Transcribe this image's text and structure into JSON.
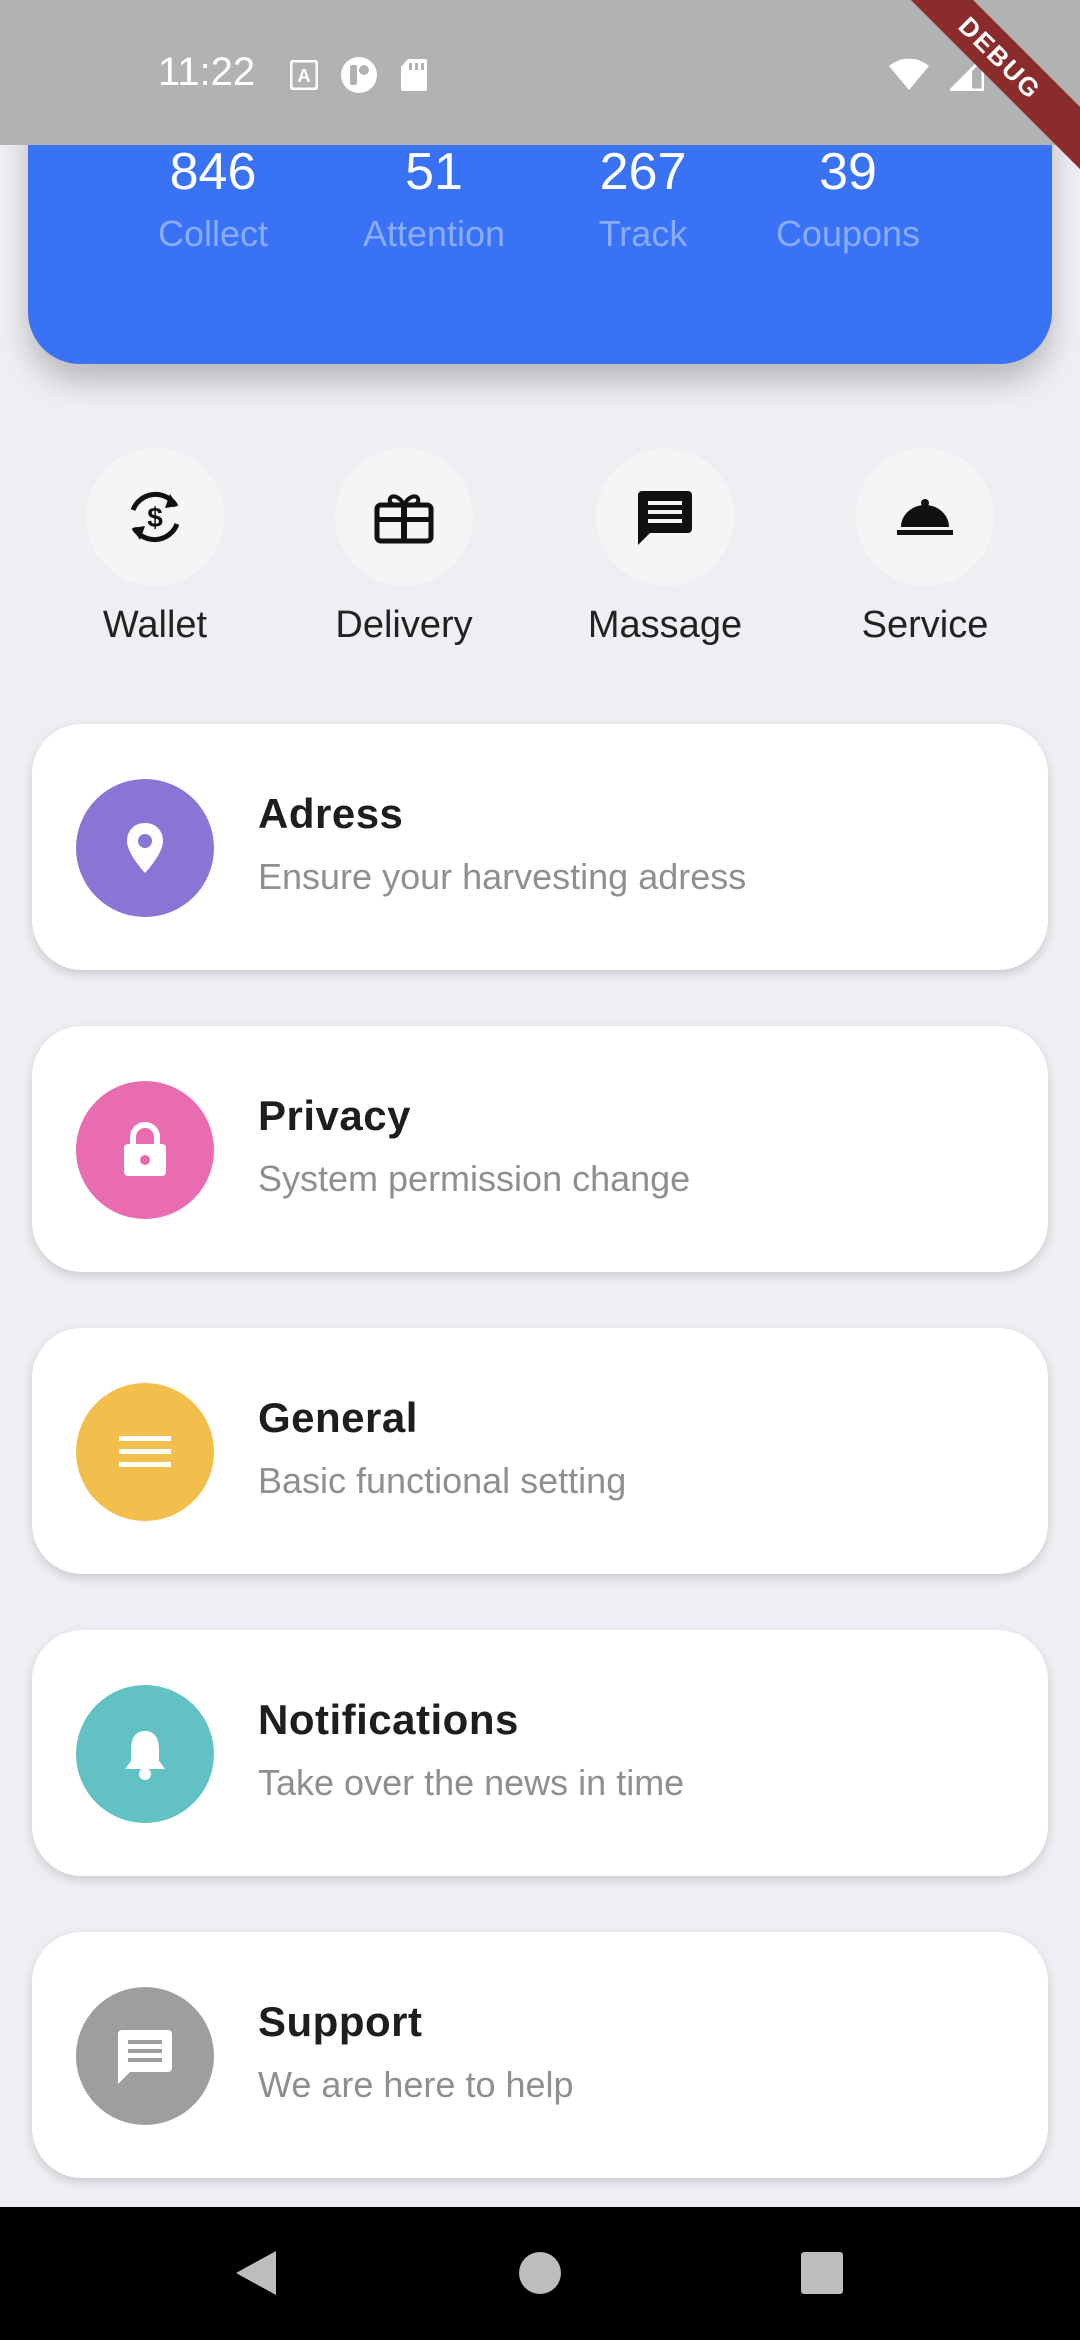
{
  "status_bar": {
    "time": "11:22",
    "left_icons": [
      "a-box-icon",
      "app-icon",
      "sd-card-icon"
    ],
    "right_icons": [
      "wifi-icon",
      "signal-icon",
      "battery-icon"
    ],
    "debug_banner": "DEBUG"
  },
  "header": {
    "accent_color": "#3a72f5",
    "stats": [
      {
        "value": "846",
        "label": "Collect"
      },
      {
        "value": "51",
        "label": "Attention"
      },
      {
        "value": "267",
        "label": "Track"
      },
      {
        "value": "39",
        "label": "Coupons"
      }
    ]
  },
  "quick_actions": [
    {
      "label": "Wallet",
      "icon": "currency-exchange-icon"
    },
    {
      "label": "Delivery",
      "icon": "gift-card-icon"
    },
    {
      "label": "Massage",
      "icon": "message-icon"
    },
    {
      "label": "Service",
      "icon": "room-service-icon"
    }
  ],
  "menu": [
    {
      "title": "Adress",
      "subtitle": "Ensure your harvesting adress",
      "icon": "location-pin-icon",
      "color": "#8a75d6"
    },
    {
      "title": "Privacy",
      "subtitle": "System permission change",
      "icon": "lock-icon",
      "color": "#e96bb0"
    },
    {
      "title": "General",
      "subtitle": "Basic functional setting",
      "icon": "menu-icon",
      "color": "#f2bf4c"
    },
    {
      "title": "Notifications",
      "subtitle": "Take over the news in time",
      "icon": "bell-icon",
      "color": "#62c1c3"
    },
    {
      "title": "Support",
      "subtitle": "We are here to help",
      "icon": "chat-icon",
      "color": "#9e9e9e"
    }
  ],
  "nav_bar": {
    "buttons": [
      "back-icon",
      "home-icon",
      "recents-icon"
    ]
  }
}
